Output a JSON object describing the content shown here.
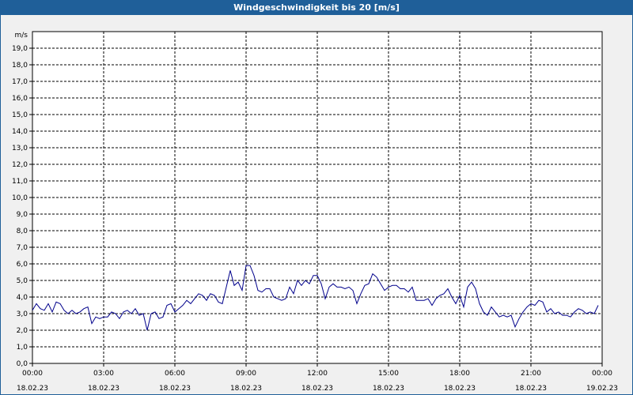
{
  "window": {
    "title": "Windgeschwindigkeit bis 20 [m/s]"
  },
  "colors": {
    "title_bg": "#1f5f99",
    "title_fg": "#ffffff",
    "line": "#00008b",
    "grid": "#000000",
    "plot_bg": "#ffffff"
  },
  "chart_data": {
    "type": "line",
    "title": "Windgeschwindigkeit bis 20 [m/s]",
    "ylabel": "m/s",
    "xlabel": "",
    "ylim": [
      0,
      20
    ],
    "xlim": [
      "18.02.23 00:00",
      "19.02.23 00:00"
    ],
    "grid": true,
    "y_ticks": [
      "0,0",
      "1,0",
      "2,0",
      "3,0",
      "4,0",
      "5,0",
      "6,0",
      "7,0",
      "8,0",
      "9,0",
      "10,0",
      "11,0",
      "12,0",
      "13,0",
      "14,0",
      "15,0",
      "16,0",
      "17,0",
      "18,0",
      "19,0"
    ],
    "x_ticks": [
      {
        "time": "00:00",
        "date": "18.02.23"
      },
      {
        "time": "03:00",
        "date": "18.02.23"
      },
      {
        "time": "06:00",
        "date": "18.02.23"
      },
      {
        "time": "09:00",
        "date": "18.02.23"
      },
      {
        "time": "12:00",
        "date": "18.02.23"
      },
      {
        "time": "15:00",
        "date": "18.02.23"
      },
      {
        "time": "18:00",
        "date": "18.02.23"
      },
      {
        "time": "21:00",
        "date": "18.02.23"
      },
      {
        "time": "00:00",
        "date": "19.02.23"
      }
    ],
    "series": [
      {
        "x": [
          "00:00",
          "00:10",
          "00:20",
          "00:30",
          "00:40",
          "00:50",
          "01:00",
          "01:10",
          "01:20",
          "01:30",
          "01:40",
          "01:50",
          "02:00",
          "02:10",
          "02:20",
          "02:30",
          "02:40",
          "02:50",
          "03:00",
          "03:10",
          "03:20",
          "03:30",
          "03:40",
          "03:50",
          "04:00",
          "04:10",
          "04:20",
          "04:30",
          "04:40",
          "04:50",
          "05:00",
          "05:10",
          "05:20",
          "05:30",
          "05:40",
          "05:50",
          "06:00",
          "06:10",
          "06:20",
          "06:30",
          "06:40",
          "06:50",
          "07:00",
          "07:10",
          "07:20",
          "07:30",
          "07:40",
          "07:50",
          "08:00",
          "08:10",
          "08:20",
          "08:30",
          "08:40",
          "08:50",
          "09:00",
          "09:10",
          "09:20",
          "09:30",
          "09:40",
          "09:50",
          "10:00",
          "10:10",
          "10:20",
          "10:30",
          "10:40",
          "10:50",
          "11:00",
          "11:10",
          "11:20",
          "11:30",
          "11:40",
          "11:50",
          "12:00",
          "12:10",
          "12:20",
          "12:30",
          "12:40",
          "12:50",
          "13:00",
          "13:10",
          "13:20",
          "13:30",
          "13:40",
          "13:50",
          "14:00",
          "14:10",
          "14:20",
          "14:30",
          "14:40",
          "14:50",
          "15:00",
          "15:10",
          "15:20",
          "15:30",
          "15:40",
          "15:50",
          "16:00",
          "16:10",
          "16:20",
          "16:30",
          "16:40",
          "16:50",
          "17:00",
          "17:10",
          "17:20",
          "17:30",
          "17:40",
          "17:50",
          "18:00",
          "18:10",
          "18:20",
          "18:30",
          "18:40",
          "18:50",
          "19:00",
          "19:10",
          "19:20",
          "19:30",
          "19:40",
          "19:50",
          "20:00",
          "20:10",
          "20:20",
          "20:30",
          "20:40",
          "20:50",
          "21:00",
          "21:10",
          "21:20",
          "21:30",
          "21:40",
          "21:50",
          "22:00",
          "22:10",
          "22:20",
          "22:30",
          "22:40",
          "22:50",
          "23:00",
          "23:10",
          "23:20",
          "23:30",
          "23:40",
          "23:50"
        ],
        "values": [
          3.2,
          3.6,
          3.3,
          3.2,
          3.6,
          3.1,
          3.7,
          3.6,
          3.2,
          3.0,
          3.2,
          3.0,
          3.1,
          3.3,
          3.4,
          2.4,
          2.8,
          2.7,
          2.8,
          2.8,
          3.1,
          3.0,
          2.7,
          3.1,
          3.2,
          3.0,
          3.3,
          2.9,
          3.0,
          2.0,
          3.0,
          3.1,
          2.7,
          2.8,
          3.5,
          3.6,
          3.1,
          3.3,
          3.5,
          3.8,
          3.6,
          3.9,
          4.2,
          4.1,
          3.8,
          4.2,
          4.1,
          3.7,
          3.6,
          4.6,
          5.6,
          4.7,
          4.9,
          4.4,
          5.9,
          5.9,
          5.3,
          4.4,
          4.3,
          4.5,
          4.5,
          4.0,
          3.9,
          3.8,
          3.9,
          4.6,
          4.2,
          5.0,
          4.7,
          5.0,
          4.8,
          5.3,
          5.3,
          4.8,
          3.9,
          4.6,
          4.8,
          4.6,
          4.6,
          4.5,
          4.6,
          4.4,
          3.6,
          4.2,
          4.7,
          4.8,
          5.4,
          5.2,
          4.8,
          4.4,
          4.6,
          4.7,
          4.7,
          4.5,
          4.5,
          4.3,
          4.6,
          3.8,
          3.8,
          3.8,
          3.9,
          3.5,
          3.9,
          4.1,
          4.2,
          4.5,
          4.0,
          3.6,
          4.1,
          3.4,
          4.6,
          4.9,
          4.5,
          3.6,
          3.1,
          2.9,
          3.4,
          3.1,
          2.8,
          2.9,
          2.8,
          2.9,
          2.2,
          2.7,
          3.1,
          3.4,
          3.6,
          3.5,
          3.8,
          3.7,
          3.1,
          3.3,
          3.0,
          3.1,
          2.9,
          2.9,
          2.8,
          3.1,
          3.3,
          3.2,
          3.0,
          3.1,
          3.0,
          3.5
        ]
      }
    ]
  }
}
